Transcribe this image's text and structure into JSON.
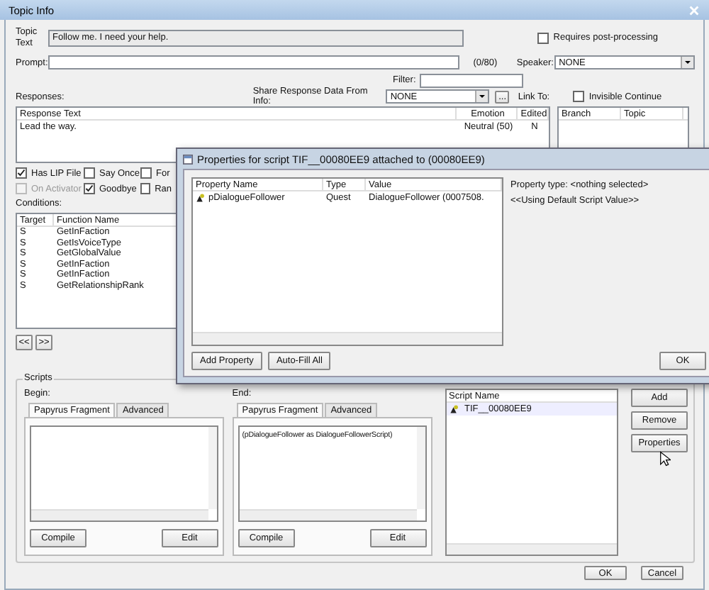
{
  "window": {
    "title": "Topic Info"
  },
  "topic_text": {
    "label": "Topic Text",
    "value": "Follow me. I need your help."
  },
  "requires_post_processing": {
    "label": "Requires post-processing",
    "checked": false
  },
  "prompt": {
    "label": "Prompt:",
    "counter": "(0/80)"
  },
  "speaker": {
    "label": "Speaker:",
    "value": "NONE"
  },
  "filter": {
    "label": "Filter:"
  },
  "responses": {
    "label": "Responses:",
    "columns": [
      "Response Text",
      "Emotion",
      "Edited"
    ],
    "rows": [
      [
        "Lead the way.",
        "Neutral (50)",
        "N"
      ]
    ]
  },
  "share_response": {
    "label": "Share Response Data From Info:",
    "value": "NONE",
    "browse": "..."
  },
  "link_to": {
    "label": "Link To:",
    "columns": [
      "Branch",
      "Topic"
    ]
  },
  "invisible_continue": {
    "label": "Invisible Continue",
    "checked": false
  },
  "flags": [
    {
      "label": "Has LIP File",
      "checked": true,
      "disabled": false
    },
    {
      "label": "Say Once",
      "checked": false,
      "disabled": false
    },
    {
      "label": "For",
      "checked": false,
      "disabled": false
    },
    {
      "label": "On Activator",
      "checked": false,
      "disabled": true
    },
    {
      "label": "Goodbye",
      "checked": true,
      "disabled": false
    },
    {
      "label": "Ran",
      "checked": false,
      "disabled": false
    }
  ],
  "conditions": {
    "label": "Conditions:",
    "columns": [
      "Target",
      "Function Name"
    ],
    "rows": [
      [
        "S",
        "GetInFaction"
      ],
      [
        "S",
        "GetIsVoiceType"
      ],
      [
        "S",
        "GetGlobalValue"
      ],
      [
        "S",
        "GetInFaction"
      ],
      [
        "S",
        "GetInFaction"
      ],
      [
        "S",
        "GetRelationshipRank"
      ]
    ]
  },
  "nav_buttons": [
    "<<",
    ">>"
  ],
  "scripts": {
    "title": "Scripts",
    "panes": [
      {
        "label": "Begin:",
        "tabs": [
          {
            "label": "Papyrus Fragment",
            "selected": true
          },
          {
            "label": "Advanced",
            "selected": false
          }
        ],
        "buttons": [
          "Compile",
          "Edit"
        ]
      },
      {
        "label": "End:",
        "tabs": [
          {
            "label": "Papyrus Fragment",
            "selected": true
          },
          {
            "label": "Advanced",
            "selected": false
          }
        ],
        "text": "(pDialogueFollower as DialogueFollowerScript)",
        "buttons": [
          "Compile",
          "Edit"
        ]
      }
    ],
    "list": {
      "column": "Script Name",
      "items": [
        "TIF__00080EE9"
      ]
    },
    "buttons": [
      "Add",
      "Remove",
      "Properties"
    ]
  },
  "footer_buttons": [
    "OK",
    "Cancel"
  ],
  "dialog": {
    "title": "Properties for script TIF__00080EE9 attached to  (00080EE9)",
    "columns": [
      "Property Name",
      "Type",
      "Value"
    ],
    "rows": [
      [
        "pDialogueFollower",
        "Quest",
        "DialogueFollower (0007508."
      ]
    ],
    "property_type": "Property type: <nothing selected>",
    "default_value": "<<Using Default Script Value>>",
    "buttons": [
      "Add Property",
      "Auto-Fill All"
    ],
    "ok": "OK"
  }
}
